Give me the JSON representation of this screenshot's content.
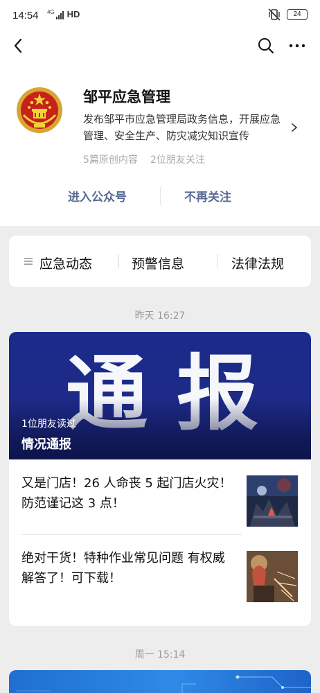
{
  "status_bar": {
    "time": "14:54",
    "network": "4G",
    "hd": "HD",
    "battery": "24"
  },
  "navbar": {
    "back_icon": "chevron-left-icon",
    "search_icon": "search-icon",
    "more_icon": "more-dots-icon"
  },
  "account": {
    "name": "邹平应急管理",
    "description": "发布邹平市应急管理局政务信息，开展应急管理、安全生产、防灾减灾知识宣传",
    "original_count": "5篇原创内容",
    "friends_following": "2位朋友关注",
    "enter_label": "进入公众号",
    "unfollow_label": "不再关注",
    "avatar_icon": "national-emblem-icon"
  },
  "menu": {
    "items": [
      "应急动态",
      "预警信息",
      "法律法规"
    ]
  },
  "feed": [
    {
      "date": "昨天 16:27",
      "cover_text": [
        "通",
        "报"
      ],
      "readers": "1位朋友读过",
      "main_title": "情况通报",
      "sub_articles": [
        {
          "title": "又是门店！26 人命丧 5 起门店火灾！防范谨记这 3 点！"
        },
        {
          "title": "绝对干货！特种作业常见问题 有权威解答了！可下载！"
        }
      ]
    },
    {
      "date": "周一 15:14"
    }
  ],
  "colors": {
    "link": "#576b95",
    "background": "#ededed",
    "cover_blue": "#1c2a8c"
  }
}
